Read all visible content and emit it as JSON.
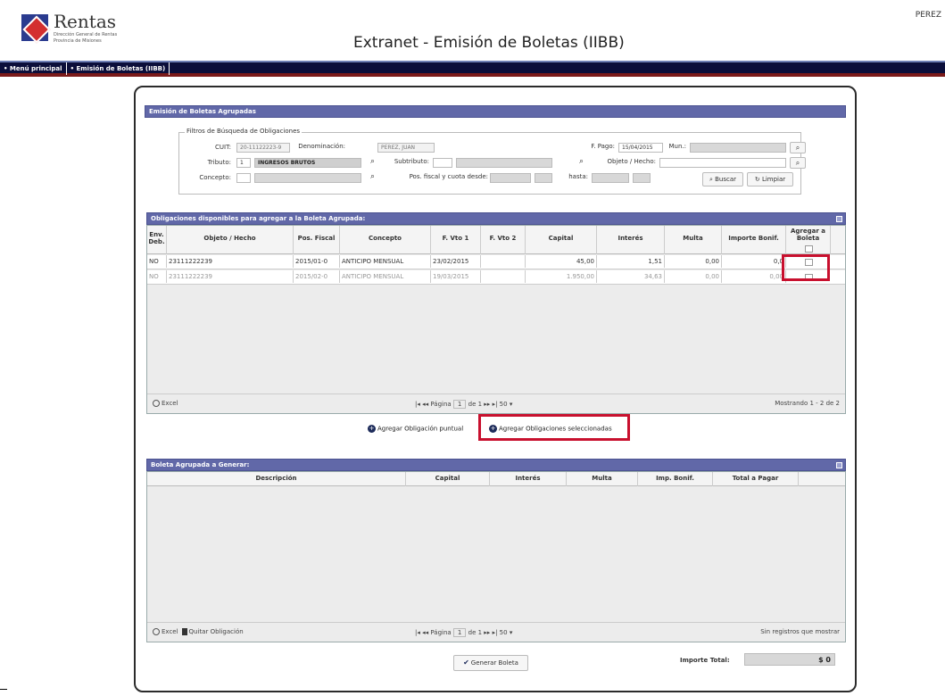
{
  "header": {
    "logo_name": "Rentas",
    "logo_sub1": "Dirección General de Rentas",
    "logo_sub2": "Provincia de Misiones",
    "title": "Extranet - Emisión de Boletas (IIBB)",
    "user": "PEREZ"
  },
  "nav": {
    "items": [
      "• Menú principal",
      "• Emisión de Boletas (IIBB)"
    ]
  },
  "section_title": "Emisión de Boletas Agrupadas",
  "filters": {
    "legend": "Filtros de Búsqueda de Obligaciones",
    "cuit_label": "CUIT:",
    "cuit_value": "20-11122223-9",
    "denominacion_label": "Denominación:",
    "denominacion_value": "PEREZ, JUAN",
    "fpago_label": "F. Pago:",
    "fpago_value": "15/04/2015",
    "mun_label": "Mun.:",
    "tributo_label": "Tributo:",
    "tributo_code": "1",
    "tributo_value": "INGRESOS BRUTOS",
    "subtributo_label": "Subtributo:",
    "objeto_label": "Objeto / Hecho:",
    "concepto_label": "Concepto:",
    "posfiscal_label": "Pos. fiscal y cuota desde:",
    "hasta_label": "hasta:",
    "buscar_label": "Buscar",
    "limpiar_label": "Limpiar"
  },
  "obligaciones": {
    "title": "Obligaciones disponibles para agregar a la Boleta Agrupada:",
    "columns": [
      "Env. Deb.",
      "Objeto / Hecho",
      "Pos. Fiscal",
      "Concepto",
      "F. Vto 1",
      "F. Vto 2",
      "Capital",
      "Interés",
      "Multa",
      "Importe Bonif.",
      "Agregar a Boleta"
    ],
    "rows": [
      [
        "NO",
        "23111222239",
        "2015/01-0",
        "ANTICIPO MENSUAL",
        "23/02/2015",
        "",
        "45,00",
        "1,51",
        "0,00",
        "0,0"
      ],
      [
        "NO",
        "23111222239",
        "2015/02-0",
        "ANTICIPO MENSUAL",
        "19/03/2015",
        "",
        "1.950,00",
        "34,63",
        "0,00",
        "0,00"
      ]
    ],
    "excel_label": "Excel",
    "page_label": "Página",
    "page_value": "1",
    "of_label": "de 1",
    "page_size": "50",
    "showing": "Mostrando 1 - 2 de 2"
  },
  "actions": {
    "puntual": "Agregar Obligación puntual",
    "seleccionadas": "Agregar Obligaciones seleccionadas"
  },
  "boleta": {
    "title": "Boleta Agrupada a Generar:",
    "columns": [
      "Descripción",
      "Capital",
      "Interés",
      "Multa",
      "Imp. Bonif.",
      "Total a Pagar"
    ],
    "excel_label": "Excel",
    "quitar_label": "Quitar Obligación",
    "page_label": "Página",
    "page_value": "1",
    "of_label": "de 1",
    "page_size": "50",
    "empty": "Sin registros que mostrar"
  },
  "generar_label": "Generar Boleta",
  "total": {
    "label": "Importe Total:",
    "value": "$ 0"
  }
}
